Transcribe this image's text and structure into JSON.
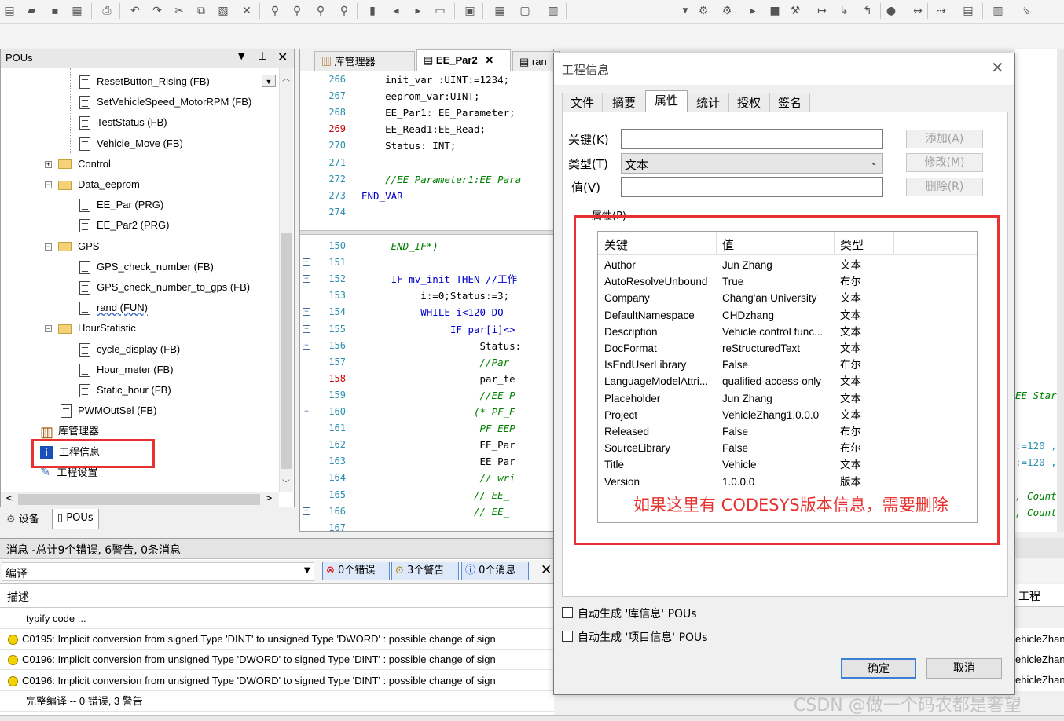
{
  "toolbar": {
    "icons": [
      "new-file-icon",
      "open-folder-icon",
      "save-icon",
      "save-all-icon",
      "print-icon",
      "undo-icon",
      "redo-icon",
      "cut-icon",
      "copy-icon",
      "paste-icon",
      "delete-icon",
      "find-icon",
      "find-replace-icon",
      "binoculars-icon",
      "find-in-files-icon",
      "bookmark-icon",
      "prev-bookmark-icon",
      "next-bookmark-icon",
      "clear-bookmark-icon",
      "view-icon",
      "grid-icon",
      "new-window-icon",
      "bin-icon",
      "login-icon",
      "logout-icon",
      "run-icon",
      "stop-icon",
      "reset-icon",
      "step-over-icon",
      "step-into-icon",
      "step-out-icon",
      "breakpoint-icon",
      "toggle-icon",
      "write-icon",
      "monitor-icon",
      "filter-icon",
      "force-icon"
    ]
  },
  "pous_panel": {
    "title": "POUs",
    "tree": [
      {
        "label": "ResetButton_Rising (FB)",
        "kind": "pou"
      },
      {
        "label": "SetVehicleSpeed_MotorRPM (FB)",
        "kind": "pou"
      },
      {
        "label": "TestStatus (FB)",
        "kind": "pou"
      },
      {
        "label": "Vehicle_Move (FB)",
        "kind": "pou"
      },
      {
        "label": "Control",
        "kind": "folder",
        "toggle": "+"
      },
      {
        "label": "Data_eeprom",
        "kind": "folder",
        "toggle": "−"
      },
      {
        "label": "EE_Par (PRG)",
        "kind": "pou"
      },
      {
        "label": "EE_Par2 (PRG)",
        "kind": "pou"
      },
      {
        "label": "GPS",
        "kind": "folder",
        "toggle": "−"
      },
      {
        "label": "GPS_check_number (FB)",
        "kind": "pou"
      },
      {
        "label": "GPS_check_number_to_gps (FB)",
        "kind": "pou"
      },
      {
        "label": "rand (FUN)",
        "kind": "pou"
      },
      {
        "label": "HourStatistic",
        "kind": "folder",
        "toggle": "−"
      },
      {
        "label": "cycle_display (FB)",
        "kind": "pou"
      },
      {
        "label": "Hour_meter (FB)",
        "kind": "pou"
      },
      {
        "label": "Static_hour (FB)",
        "kind": "pou"
      },
      {
        "label": "PWMOutSel (FB)",
        "kind": "pou"
      },
      {
        "label": "库管理器",
        "kind": "library"
      },
      {
        "label": "工程信息",
        "kind": "info"
      },
      {
        "label": "工程设置",
        "kind": "settings"
      }
    ],
    "bottom_tabs": [
      "设备",
      "POUs"
    ]
  },
  "editor": {
    "tabs": [
      "库管理器",
      "EE_Par2",
      "ran"
    ],
    "top_lines": [
      {
        "n": "266",
        "code": "    init_var :UINT:=1234;"
      },
      {
        "n": "267",
        "code": "    eeprom_var:UINT;"
      },
      {
        "n": "268",
        "code": "    EE_Par1: EE_Parameter;"
      },
      {
        "n": "269",
        "code": "    EE_Read1:EE_Read;"
      },
      {
        "n": "270",
        "code": "    Status: INT;"
      },
      {
        "n": "271",
        "code": ""
      },
      {
        "n": "272",
        "code": "    //EE_Parameter1:EE_Para"
      },
      {
        "n": "273",
        "code": "END_VAR"
      },
      {
        "n": "274",
        "code": ""
      }
    ],
    "bottom_lines": [
      {
        "n": "150",
        "code": "     END_IF*)"
      },
      {
        "n": "151",
        "code": ""
      },
      {
        "n": "152",
        "code": "     IF mv_init THEN //工作"
      },
      {
        "n": "153",
        "code": "          i:=0;Status:=3;"
      },
      {
        "n": "154",
        "code": "          WHILE i<120 DO"
      },
      {
        "n": "155",
        "code": "               IF par[i]<>"
      },
      {
        "n": "156",
        "code": "                    Status:"
      },
      {
        "n": "157",
        "code": "                    //Par_"
      },
      {
        "n": "158",
        "code": "                    par_te"
      },
      {
        "n": "159",
        "code": "                    //EE_P"
      },
      {
        "n": "160",
        "code": "                   (* PF_E"
      },
      {
        "n": "161",
        "code": "                    PF_EEP"
      },
      {
        "n": "162",
        "code": "                    EE_Par"
      },
      {
        "n": "163",
        "code": "                    EE_Par"
      },
      {
        "n": "164",
        "code": "                    // wri"
      },
      {
        "n": "165",
        "code": "                   // EE_"
      },
      {
        "n": "166",
        "code": "                   // EE_"
      },
      {
        "n": "167",
        "code": ""
      }
    ],
    "right_fragments": [
      "EE_Start",
      ":=120 ,",
      ":=120 ,",
      ", Count",
      ", Count"
    ]
  },
  "messages": {
    "header": "消息 -总计9个错误, 6警告, 0条消息",
    "filter": "编译",
    "errors_btn": "0个错误",
    "warnings_btn": "3个警告",
    "messages_btn": "0个消息",
    "col_desc": "描述",
    "col_project": "工程",
    "rows": [
      {
        "text": "typify code ...",
        "icon": ""
      },
      {
        "text": "C0195: Implicit conversion from signed Type 'DINT' to unsigned Type 'DWORD' : possible change of sign",
        "icon": "!"
      },
      {
        "text": "C0196: Implicit conversion from unsigned Type 'DWORD' to signed Type 'DINT' : possible change of sign",
        "icon": "!"
      },
      {
        "text": "C0196: Implicit conversion from unsigned Type 'DWORD' to signed Type 'DINT' : possible change of sign",
        "icon": "!"
      },
      {
        "text": "完整编译 -- 0 错误, 3 警告",
        "icon": ""
      }
    ],
    "project_fragments": [
      "ehicleZhang",
      "ehicleZhang",
      "ehicleZhang"
    ]
  },
  "dialog": {
    "title": "工程信息",
    "tabs": [
      "文件",
      "摘要",
      "属性",
      "统计",
      "授权",
      "签名"
    ],
    "active_tab": "属性",
    "key_label": "关键(K)",
    "type_label": "类型(T)",
    "value_label": "值(V)",
    "key_value": "",
    "type_value": "文本",
    "value_value": "",
    "add_btn": "添加(A)",
    "modify_btn": "修改(M)",
    "delete_btn": "删除(R)",
    "props_group": "属性(P)",
    "columns": [
      "关键",
      "值",
      "类型"
    ],
    "properties": [
      {
        "key": "Author",
        "value": "Jun Zhang",
        "type": "文本"
      },
      {
        "key": "AutoResolveUnbound",
        "value": "True",
        "type": "布尔"
      },
      {
        "key": "Company",
        "value": "Chang'an University",
        "type": "文本"
      },
      {
        "key": "DefaultNamespace",
        "value": "CHDzhang",
        "type": "文本"
      },
      {
        "key": "Description",
        "value": "Vehicle control func...",
        "type": "文本"
      },
      {
        "key": "DocFormat",
        "value": "reStructuredText",
        "type": "文本"
      },
      {
        "key": "IsEndUserLibrary",
        "value": "False",
        "type": "布尔"
      },
      {
        "key": "LanguageModelAttri...",
        "value": "qualified-access-only",
        "type": "文本"
      },
      {
        "key": "Placeholder",
        "value": "Jun Zhang",
        "type": "文本"
      },
      {
        "key": "Project",
        "value": "VehicleZhang1.0.0.0",
        "type": "文本"
      },
      {
        "key": "Released",
        "value": "False",
        "type": "布尔"
      },
      {
        "key": "SourceLibrary",
        "value": "False",
        "type": "布尔"
      },
      {
        "key": "Title",
        "value": "Vehicle",
        "type": "文本"
      },
      {
        "key": "Version",
        "value": "1.0.0.0",
        "type": "版本"
      }
    ],
    "annotation": "如果这里有 CODESYS版本信息，需要删除",
    "auto_lib_info": "自动生成 '库信息' POUs",
    "auto_proj_info": "自动生成 '项目信息' POUs",
    "ok": "确定",
    "cancel": "取消"
  },
  "watermark": "CSDN @做一个码农都是奢望",
  "colors": {
    "annotation_red": "#e8322f",
    "keyword_blue": "#0000cc",
    "comment_green": "#008000",
    "line_number": "#2b91af"
  }
}
